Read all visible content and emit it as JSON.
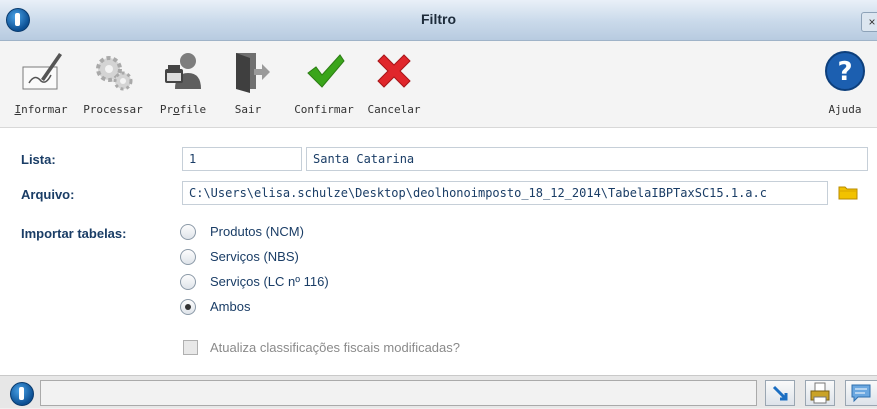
{
  "window": {
    "title": "Filtro",
    "close_label": "×"
  },
  "toolbar": {
    "informar": "nformar",
    "processar": "Processar",
    "profile_a": "Pr",
    "profile_b": "o",
    "profile_c": "file",
    "sair": "Sair",
    "confirmar": "Confirmar",
    "cancelar": "Cancelar",
    "ajuda": "Ajuda"
  },
  "form": {
    "lista_label": "Lista:",
    "lista_code": "1",
    "lista_name": "Santa Catarina",
    "arquivo_label": "Arquivo:",
    "arquivo_value": "C:\\Users\\elisa.schulze\\Desktop\\deolhonoimposto_18_12_2014\\TabelaIBPTaxSC15.1.a.c",
    "importar_label": "Importar tabelas:",
    "options": [
      {
        "label": "Produtos (NCM)",
        "selected": false
      },
      {
        "label": "Serviços (NBS)",
        "selected": false
      },
      {
        "label": "Serviços (LC nº 116)",
        "selected": false
      },
      {
        "label": "Ambos",
        "selected": true
      }
    ],
    "atualiza_label": "Atualiza classificações fiscais modificadas?",
    "atualiza_checked": false
  },
  "colors": {
    "label": "#1a3d66",
    "accent": "#0b4f93",
    "confirm": "#3aa51b",
    "cancel": "#e0262b"
  }
}
